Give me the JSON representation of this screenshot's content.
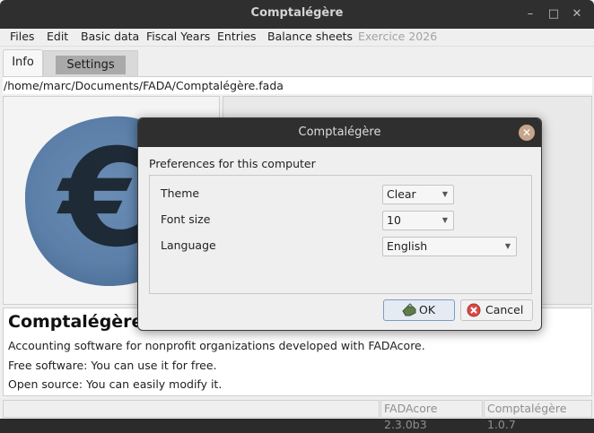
{
  "window": {
    "title": "Comptalégère"
  },
  "menu": [
    {
      "label": "Files",
      "enabled": true
    },
    {
      "label": "Edit",
      "enabled": true
    },
    {
      "label": "Basic data",
      "enabled": true
    },
    {
      "label": "Fiscal Years",
      "enabled": true
    },
    {
      "label": "Entries",
      "enabled": true
    },
    {
      "label": "Balance sheets",
      "enabled": true
    },
    {
      "label": "Exercice 2026",
      "enabled": false
    }
  ],
  "tabs": {
    "info": "Info",
    "settings": "Settings",
    "active": "info"
  },
  "file_path": "/home/marc/Documents/FADA/Comptalégère.fada",
  "logo": {
    "glyph": "€",
    "color": "#5b7fa8"
  },
  "about": {
    "title": "Comptalégère",
    "lines": [
      "Accounting software for nonprofit organizations developed with FADAcore.",
      "Free software: You can use it for free.",
      "Open source: You can easily modify it."
    ]
  },
  "status": {
    "core_version": "FADAcore 2.3.0b3",
    "app_version": "Comptalégère 1.0.7"
  },
  "dialog": {
    "title": "Comptalégère",
    "section_label": "Preferences for this computer",
    "prefs": [
      {
        "label": "Theme",
        "value": "Clear"
      },
      {
        "label": "Font size",
        "value": "10"
      },
      {
        "label": "Language",
        "value": "English"
      }
    ],
    "ok_label": "OK",
    "cancel_label": "Cancel"
  },
  "colors": {
    "titlebar": "#2f2f2f",
    "window_bg": "#efefef",
    "accent_button_border": "#7a9cc6",
    "close_button": "#c7a58b"
  }
}
